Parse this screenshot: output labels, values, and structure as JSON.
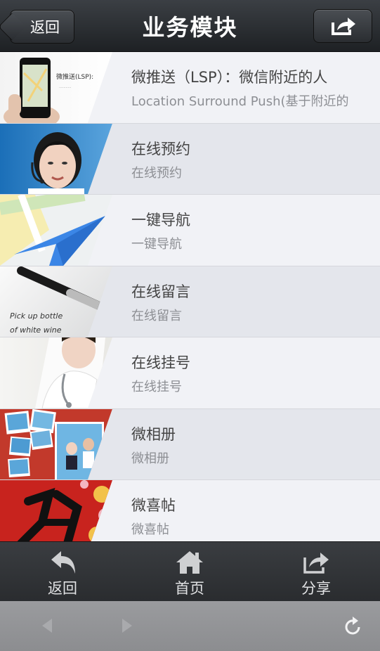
{
  "header": {
    "back_label": "返回",
    "title": "业务模块"
  },
  "list": {
    "items": [
      {
        "title": "微推送（LSP）：微信附近的人",
        "subtitle": "Location Surround Push(基于附近的",
        "thumb_caption": "微推送(LSP):"
      },
      {
        "title": "在线预约",
        "subtitle": "在线预约"
      },
      {
        "title": "一键导航",
        "subtitle": "一键导航"
      },
      {
        "title": "在线留言",
        "subtitle": "在线留言",
        "thumb_caption": "Pick up bottle of white wine"
      },
      {
        "title": "在线挂号",
        "subtitle": "在线挂号"
      },
      {
        "title": "微相册",
        "subtitle": "微相册"
      },
      {
        "title": "微喜帖",
        "subtitle": "微喜帖"
      }
    ]
  },
  "toolbar": {
    "back_label": "返回",
    "home_label": "首页",
    "share_label": "分享"
  },
  "icons": {
    "header_share": "share-icon",
    "toolbar_back": "undo-arrow-icon",
    "toolbar_home": "home-icon",
    "toolbar_share": "share-icon",
    "browser_back": "back-arrow-icon",
    "browser_forward": "forward-arrow-icon",
    "browser_reload": "reload-icon"
  },
  "colors": {
    "header_bg": "#2a2d31",
    "toolbar_bg": "#323538",
    "browser_bar_bg": "#939497",
    "row_odd": "#f1f2f6",
    "row_even": "#e4e6ec"
  }
}
